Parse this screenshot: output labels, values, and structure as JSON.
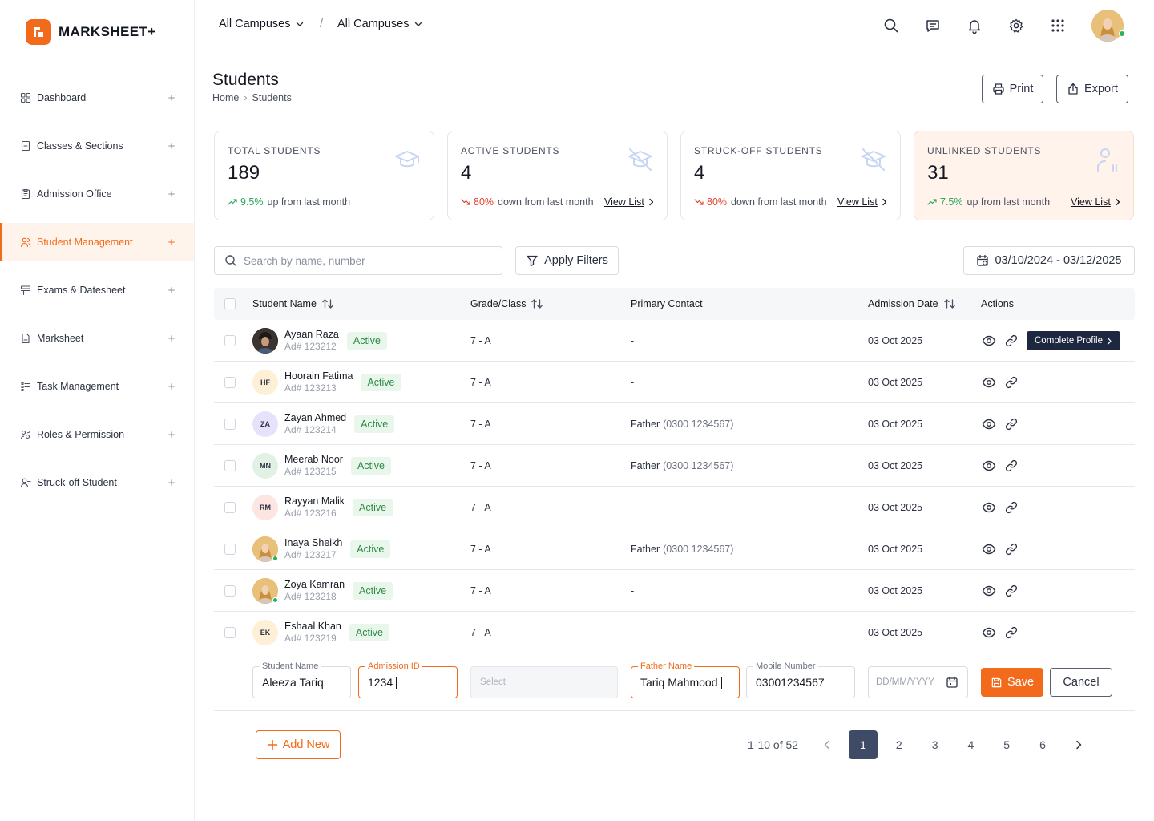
{
  "app": {
    "brand": "MARKSHEET+"
  },
  "sidebar": {
    "items": [
      {
        "label": "Dashboard",
        "icon": "grid-icon"
      },
      {
        "label": "Classes & Sections",
        "icon": "book-icon"
      },
      {
        "label": "Admission Office",
        "icon": "clipboard-icon"
      },
      {
        "label": "Student Management",
        "icon": "users-icon",
        "active": true
      },
      {
        "label": "Exams & Datesheet",
        "icon": "list-icon"
      },
      {
        "label": "Marksheet",
        "icon": "document-icon"
      },
      {
        "label": "Task Management",
        "icon": "tasks-icon"
      },
      {
        "label": "Roles & Permission",
        "icon": "roles-icon"
      },
      {
        "label": "Struck-off Student",
        "icon": "user-minus-icon"
      }
    ],
    "expand_symbol": "+"
  },
  "topbar": {
    "campus_left": "All Campuses",
    "separator": "/",
    "campus_right": "All Campuses"
  },
  "page": {
    "title": "Students",
    "breadcrumb": [
      "Home",
      "Students"
    ],
    "print_label": "Print",
    "export_label": "Export"
  },
  "stats": [
    {
      "label": "TOTAL STUDENTS",
      "value": "189",
      "pct": "9.5%",
      "direction": "up",
      "text": "up from last month",
      "link": ""
    },
    {
      "label": "ACTIVE STUDENTS",
      "value": "4",
      "pct": "80%",
      "direction": "down",
      "text": "down from last month",
      "link": "View List"
    },
    {
      "label": "STRUCK-OFF STUDENTS",
      "value": "4",
      "pct": "80%",
      "direction": "down",
      "text": "down from last month",
      "link": "View List"
    },
    {
      "label": "UNLINKED STUDENTS",
      "value": "31",
      "pct": "7.5%",
      "direction": "up",
      "text": "up from last month",
      "link": "View List"
    }
  ],
  "filters": {
    "search_placeholder": "Search by name, number",
    "apply_label": "Apply Filters",
    "date_range": "03/10/2024 - 03/12/2025"
  },
  "table": {
    "headers": {
      "name": "Student Name",
      "grade": "Grade/Class",
      "contact": "Primary Contact",
      "date": "Admission Date",
      "actions": "Actions"
    },
    "complete_profile_label": "Complete Profile",
    "rows": [
      {
        "name": "Ayaan Raza",
        "ad": "Ad# 123212",
        "initials": "",
        "avatar_color": "#3b3330",
        "photo": true,
        "status": "Active",
        "grade": "7 - A",
        "contact_rel": "-",
        "contact_num": "",
        "date": "03 Oct 2025",
        "complete": true
      },
      {
        "name": "Hoorain Fatima",
        "ad": "Ad# 123213",
        "initials": "HF",
        "avatar_color": "#fdf0d6",
        "photo": false,
        "status": "Active",
        "grade": "7 - A",
        "contact_rel": "-",
        "contact_num": "",
        "date": "03 Oct 2025",
        "complete": false
      },
      {
        "name": "Zayan Ahmed",
        "ad": "Ad# 123214",
        "initials": "ZA",
        "avatar_color": "#e6e2fb",
        "photo": false,
        "status": "Active",
        "grade": "7 - A",
        "contact_rel": "Father",
        "contact_num": "(0300 1234567)",
        "date": "03 Oct 2025",
        "complete": false
      },
      {
        "name": "Meerab Noor",
        "ad": "Ad# 123215",
        "initials": "MN",
        "avatar_color": "#e1f1e4",
        "photo": false,
        "status": "Active",
        "grade": "7 - A",
        "contact_rel": "Father",
        "contact_num": "(0300 1234567)",
        "date": "03 Oct 2025",
        "complete": false
      },
      {
        "name": "Rayyan Malik",
        "ad": "Ad# 123216",
        "initials": "RM",
        "avatar_color": "#fde6e1",
        "photo": false,
        "status": "Active",
        "grade": "7 - A",
        "contact_rel": "-",
        "contact_num": "",
        "date": "03 Oct 2025",
        "complete": false
      },
      {
        "name": "Inaya Sheikh",
        "ad": "Ad# 123217",
        "initials": "",
        "avatar_color": "#e9c07a",
        "photo": true,
        "status": "Active",
        "grade": "7 - A",
        "contact_rel": "Father",
        "contact_num": "(0300 1234567)",
        "date": "03 Oct 2025",
        "complete": false
      },
      {
        "name": "Zoya Kamran",
        "ad": "Ad# 123218",
        "initials": "",
        "avatar_color": "#e9c07a",
        "photo": true,
        "status": "Active",
        "grade": "7 - A",
        "contact_rel": "-",
        "contact_num": "",
        "date": "03 Oct 2025",
        "complete": false
      },
      {
        "name": "Eshaal Khan",
        "ad": "Ad# 123219",
        "initials": "EK",
        "avatar_color": "#fdf0d6",
        "photo": false,
        "status": "Active",
        "grade": "7 - A",
        "contact_rel": "-",
        "contact_num": "",
        "date": "03 Oct 2025",
        "complete": false
      }
    ]
  },
  "new_row": {
    "student_name_label": "Student Name",
    "student_name_value": "Aleeza Tariq",
    "admission_label": "Admission ID",
    "admission_value": "1234",
    "select_placeholder": "Select",
    "father_label": "Father Name",
    "father_value": "Tariq Mahmood",
    "mobile_label": "Mobile Number",
    "mobile_value": "03001234567",
    "date_placeholder": "DD/MM/YYYY",
    "save_label": "Save",
    "cancel_label": "Cancel"
  },
  "footer": {
    "add_new_label": "Add New",
    "range": "1-10 of 52",
    "pages": [
      "1",
      "2",
      "3",
      "4",
      "5",
      "6"
    ],
    "current_page": "1"
  },
  "colors": {
    "accent": "#f26a1b",
    "navy": "#1e2740",
    "success": "#2aa55a",
    "danger": "#e0432f"
  }
}
